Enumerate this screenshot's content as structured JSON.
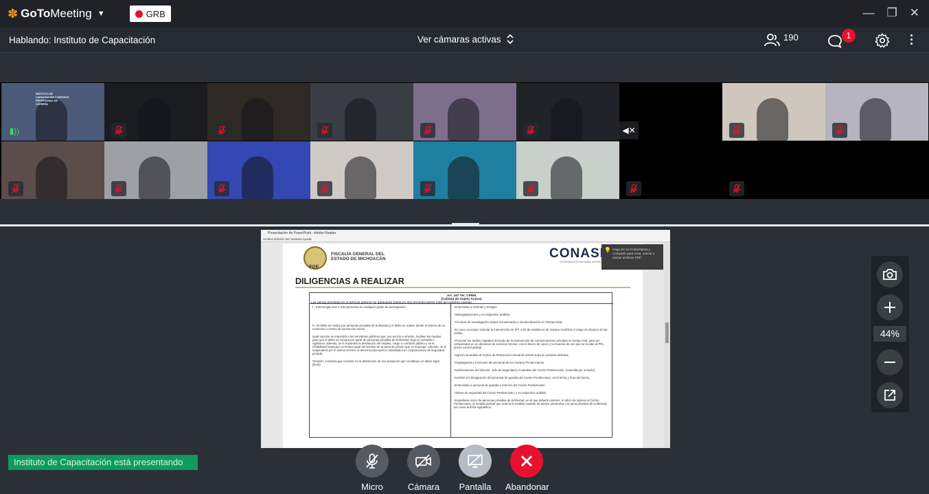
{
  "titlebar": {
    "brand_bold": "GoTo",
    "brand_regular": "Meeting",
    "recording_label": "GRB"
  },
  "subbar": {
    "speaking": "Hablando: Instituto de Capacitación",
    "view_cams": "Ver cámaras activas",
    "participant_count": "190",
    "chat_badge": "1"
  },
  "video_tiles": [
    {
      "mic": "on",
      "bg": "#4a5a78",
      "sign": "INSTITUTO DE CAPACITACIÓN Y SERVICIO PROFESIONAL DE CARRERA"
    },
    {
      "mic": "off",
      "bg": "#1a1c20"
    },
    {
      "mic": "off",
      "bg": "#2e2925"
    },
    {
      "mic": "off",
      "bg": "#3a3d44"
    },
    {
      "mic": "off",
      "bg": "#7d6f8c"
    },
    {
      "mic": "off",
      "bg": "#202328"
    },
    {
      "mic": "speaker-off",
      "bg": "#000000"
    },
    {
      "mic": "off",
      "bg": "#cfc7bd"
    },
    {
      "mic": "off",
      "bg": "#b6b4c0"
    },
    {
      "mic": "off",
      "bg": "#5a4d4a"
    },
    {
      "mic": "off",
      "bg": "#9da1a6"
    },
    {
      "mic": "off",
      "bg": "#3348b3"
    },
    {
      "mic": "off",
      "bg": "#cfcac6"
    },
    {
      "mic": "off",
      "bg": "#1f7fa0"
    },
    {
      "mic": "off",
      "bg": "#c9d0c9"
    },
    {
      "mic": "off",
      "bg": "#000000"
    },
    {
      "mic": "off",
      "bg": "#000000"
    }
  ],
  "shared_doc": {
    "window_title": "Presentación de PowerPoint - Adobe Reader",
    "menu": "Archivo   Edición   Ver   Ventana   Ayuda",
    "org_name_line1": "FISCALÍA GENERAL DEL",
    "org_name_line2": "ESTADO DE MICHOACÁN",
    "org_abbr": "FGE",
    "conasi": "CONASI",
    "conasi_sub": "COORDINACIÓN NACIONAL ANTISECUESTRO",
    "tooltip": "Haga clic en Comentarios y Compartir para crear, marcar y revisar archivos PDF.",
    "heading": "DILIGENCIAS A REALIZAR",
    "table_title_1": "Art. 167 Ter. CPEM",
    "table_title_2": "(Calidad de Sujeto Activo)",
    "table_title_3": "Las penas previstas en el artículo anterior se agravarán hasta en dos terceras partes más del máximo cuando:",
    "left": [
      "I.- Intervengan dos o más personas en cualquier grado de participación.",
      "II.- El delito se realice por personas privadas de la libertad y el delito se realice desde el interior de un reclusorio o centro de reinserción social.",
      "Igual sanción se impondrá a los servidores públicos que, por acción u omisión, faciliten los medios para que el delito se cometa por parte de personas privadas de la libertad, bajo su custodia o vigilancia; además, se le impondrá la destitución del empleo, cargo o comisión público y se le inhabilitará hasta por un tiempo igual del término de la pena de prisión que se imponga. Además, se le suspenderá por el mismo término el derecho para ejercer actividades en corporaciones de seguridad privada.",
      "Omisión: conducta que consiste en la abstención de una actuación que constituye un deber legal. (RAE)"
    ],
    "right": [
      "-Entrevistas a víctimas y testigos.",
      "-Videograbaciones y su respectivo análisis.",
      "-Técnicas de Investigación (Datos Conservados y Geolocalización en Tiempo Real.",
      "-En caso necesario solicitar la intervención de IPT, a fin de establecer de manera científica el rango de alcance de las celdas.",
      "-Procesar los audios captados derivado de la intervención de comunicaciones privadas en tiempo real, para ser comparados en un dictamen de acústica forense, con el banco de voces y la muestra de voz que se recabe al PPL, previo control judicial.",
      "-Ingreso inmediato al Centro de Reinserción Social de donde surja la conducta delictiva.",
      "-Organigrama y funciones del personal de los Centros Penitenciarios.",
      "-Nombramiento del Director, Jefe de Seguridad y Custodios del Centro Penitenciario. (custodia por omisión)",
      "-Nombre y/o designación del personal de guardia del Centro Penitenciario, en la fecha y hora del hecho.",
      "-Entrevistas a personal de guardia e internos del Centro Penitenciario.",
      "-Videos de seguridad del Centro Penitenciario, y su respectivo análisis.",
      "-Expediente único de personas privadas de la libertad, en el que deberá contener, el oficio de ingreso al Centro Penitenciario, la medida judicial que ordena la medida cautelar de prisión preventiva o la pena privativa de la libertad, así como la ficha signalética."
    ]
  },
  "zoom": {
    "level": "44%"
  },
  "presenting_banner": "Instituto de Capacitación está presentando",
  "controls": {
    "mic": "Micro",
    "camera": "Cámara",
    "screen": "Pantalla",
    "leave": "Abandonar"
  },
  "colors": {
    "brand_orange": "#f7931e",
    "record_red": "#e8112d",
    "presenting_green": "#0d9c5c",
    "leave_red": "#e8112d",
    "screen_blue": "#b4bcc6"
  }
}
